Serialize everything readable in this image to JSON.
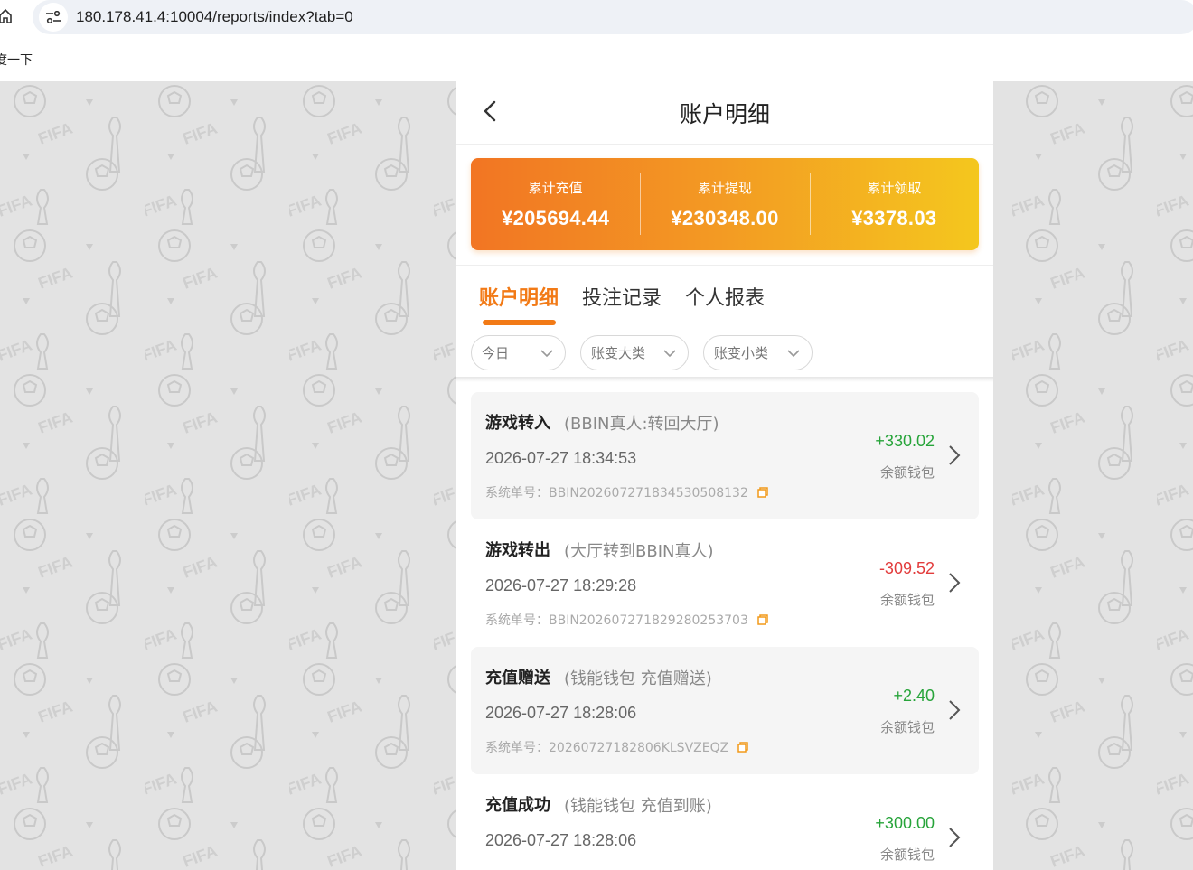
{
  "browser": {
    "url": "180.178.41.4:10004/reports/index?tab=0",
    "bookmark_label": "度一下"
  },
  "header": {
    "title": "账户明细"
  },
  "summary": {
    "items": [
      {
        "label": "累计充值",
        "value": "¥205694.44"
      },
      {
        "label": "累计提现",
        "value": "¥230348.00"
      },
      {
        "label": "累计领取",
        "value": "¥3378.03"
      }
    ]
  },
  "tabs": {
    "items": [
      {
        "label": "账户明细",
        "active": true
      },
      {
        "label": "投注记录",
        "active": false
      },
      {
        "label": "个人报表",
        "active": false
      }
    ]
  },
  "filters": {
    "items": [
      {
        "value": "今日"
      },
      {
        "value": "账变大类"
      },
      {
        "value": "账变小类"
      }
    ]
  },
  "records": [
    {
      "title": "游戏转入",
      "subtitle": "(BBIN真人:转回大厅)",
      "time": "2026-07-27 18:34:53",
      "order": "系统单号：BBIN20260727183453050813​2",
      "amount": "+330.02",
      "wallet": "余额钱包"
    },
    {
      "title": "游戏转出",
      "subtitle": "(大厅转到BBIN真人)",
      "time": "2026-07-27 18:29:28",
      "order": "系统单号：BBIN20260727182928025370​3",
      "amount": "-309.52",
      "wallet": "余额钱包"
    },
    {
      "title": "充值赠送",
      "subtitle": "(钱能钱包 充值赠送)",
      "time": "2026-07-27 18:28:06",
      "order": "系统单号：20260727182806KLSVZEQZ",
      "amount": "+2.40",
      "wallet": "余额钱包"
    },
    {
      "title": "充值成功",
      "subtitle": "(钱能钱包 充值到账)",
      "time": "2026-07-27 18:28:06",
      "order": "",
      "amount": "+300.00",
      "wallet": "余额钱包"
    }
  ],
  "colors": {
    "accent": "#f27a16",
    "positive": "#27a43a",
    "negative": "#e23c3c",
    "card_gradient_start": "#f27523",
    "card_gradient_end": "#f4c71e"
  }
}
